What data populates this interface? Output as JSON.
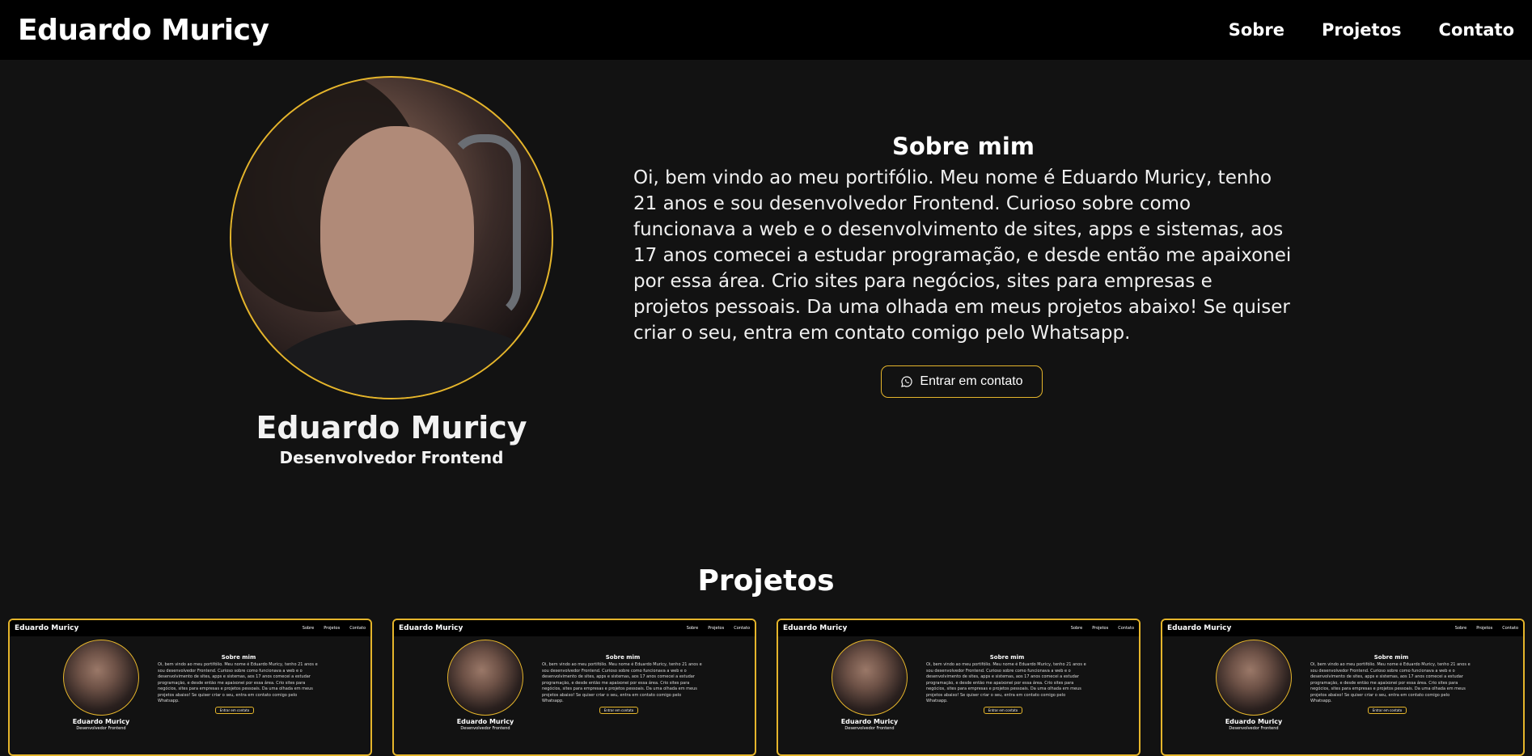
{
  "header": {
    "brand": "Eduardo Muricy",
    "nav": [
      "Sobre",
      "Projetos",
      "Contato"
    ]
  },
  "hero": {
    "name": "Eduardo Muricy",
    "role": "Desenvolvedor Frontend",
    "about_title": "Sobre mim",
    "about_text": "Oi, bem vindo ao meu portifólio. Meu nome é Eduardo Muricy, tenho 21 anos e sou desenvolvedor Frontend. Curioso sobre como funcionava a web e o desenvolvimento de sites, apps e sistemas, aos 17 anos comecei a estudar programação, e desde então me apaixonei por essa área. Crio sites para negócios, sites para empresas e projetos pessoais. Da uma olhada em meus projetos abaixo! Se quiser criar o seu, entra em contato comigo pelo Whatsapp.",
    "contact_button": "Entrar em contato",
    "contact_icon": "whatsapp-icon"
  },
  "projects": {
    "title": "Projetos",
    "cards": [
      {
        "brand": "Eduardo Muricy",
        "nav": [
          "Sobre",
          "Projetos",
          "Contato"
        ],
        "name": "Eduardo Muricy",
        "role": "Desenvolvedor Frontend",
        "about_title": "Sobre mim",
        "button": "Entrar em contato"
      },
      {
        "brand": "Eduardo Muricy",
        "nav": [
          "Sobre",
          "Projetos",
          "Contato"
        ],
        "name": "Eduardo Muricy",
        "role": "Desenvolvedor Frontend",
        "about_title": "Sobre mim",
        "button": "Entrar em contato"
      },
      {
        "brand": "Eduardo Muricy",
        "nav": [
          "Sobre",
          "Projetos",
          "Contato"
        ],
        "name": "Eduardo Muricy",
        "role": "Desenvolvedor Frontend",
        "about_title": "Sobre mim",
        "button": "Entrar em contato"
      },
      {
        "brand": "Eduardo Muricy",
        "nav": [
          "Sobre",
          "Projetos",
          "Contato"
        ],
        "name": "Eduardo Muricy",
        "role": "Desenvolvedor Frontend",
        "about_title": "Sobre mim",
        "button": "Entrar em contato"
      }
    ]
  },
  "colors": {
    "background": "#121212",
    "header": "#000000",
    "accent": "#e5b52b",
    "text": "#ffffff"
  }
}
